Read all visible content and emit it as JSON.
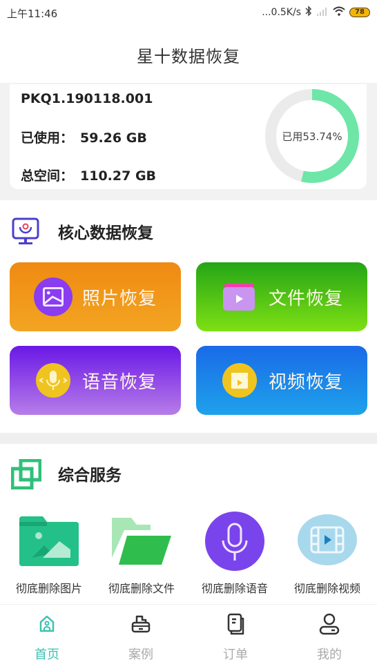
{
  "status_bar": {
    "time": "上午11:46",
    "network_speed": "...0.5K/s",
    "battery": "78"
  },
  "header": {
    "title": "星十数据恢复"
  },
  "storage": {
    "device_id": "PKQ1.190118.001",
    "used_label": "已使用：",
    "used_value": "59.26 GB",
    "total_label": "总空间：",
    "total_value": "110.27 GB",
    "usage_text": "已用53.74%",
    "usage_fraction": 0.5374,
    "colors": {
      "used": "#6ee6a8",
      "free": "#ebebeb"
    }
  },
  "core_section": {
    "title": "核心数据恢复",
    "tiles": [
      {
        "label": "照片恢复",
        "icon": "photo-icon"
      },
      {
        "label": "文件恢复",
        "icon": "folder-video-icon"
      },
      {
        "label": "语音恢复",
        "icon": "microphone-icon"
      },
      {
        "label": "视频恢复",
        "icon": "clapperboard-icon"
      }
    ]
  },
  "service_section": {
    "title": "综合服务",
    "items": [
      {
        "label": "彻底删除图片",
        "icon": "image-folder-icon"
      },
      {
        "label": "彻底删除文件",
        "icon": "open-folder-icon"
      },
      {
        "label": "彻底删除语音",
        "icon": "microphone-icon"
      },
      {
        "label": "彻底删除视频",
        "icon": "film-icon"
      }
    ]
  },
  "tabbar": {
    "active_color": "#3cc1b0",
    "tabs": [
      {
        "label": "首页",
        "icon": "home-icon",
        "active": true
      },
      {
        "label": "案例",
        "icon": "case-icon",
        "active": false
      },
      {
        "label": "订单",
        "icon": "orders-icon",
        "active": false
      },
      {
        "label": "我的",
        "icon": "user-icon",
        "active": false
      }
    ]
  }
}
